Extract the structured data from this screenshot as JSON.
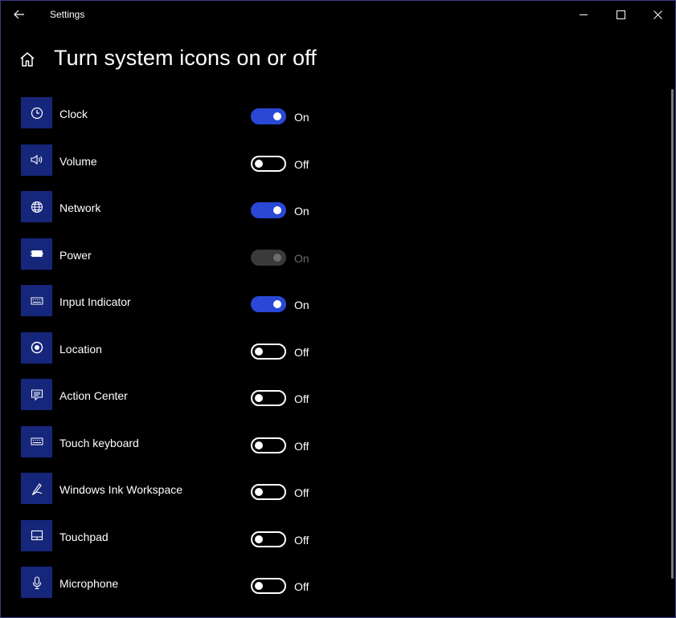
{
  "window": {
    "title": "Settings",
    "icons": {
      "back": "back-arrow-icon",
      "minimize": "minimize-icon",
      "maximize": "maximize-icon",
      "close": "close-icon"
    }
  },
  "page": {
    "title": "Turn system icons on or off",
    "home_icon": "home-icon"
  },
  "colors": {
    "accent": "#2a48d6",
    "tile": "#16267a",
    "disabled": "#3a3a3a",
    "disabled_text": "#6d6d6d"
  },
  "items": [
    {
      "label": "Clock",
      "icon": "clock-icon",
      "state": "On",
      "on": true,
      "disabled": false
    },
    {
      "label": "Volume",
      "icon": "volume-icon",
      "state": "Off",
      "on": false,
      "disabled": false
    },
    {
      "label": "Network",
      "icon": "globe-icon",
      "state": "On",
      "on": true,
      "disabled": false
    },
    {
      "label": "Power",
      "icon": "battery-icon",
      "state": "On",
      "on": true,
      "disabled": true
    },
    {
      "label": "Input Indicator",
      "icon": "keyboard-icon",
      "state": "On",
      "on": true,
      "disabled": false
    },
    {
      "label": "Location",
      "icon": "location-icon",
      "state": "Off",
      "on": false,
      "disabled": false
    },
    {
      "label": "Action Center",
      "icon": "action-center-icon",
      "state": "Off",
      "on": false,
      "disabled": false
    },
    {
      "label": "Touch keyboard",
      "icon": "keyboard-icon",
      "state": "Off",
      "on": false,
      "disabled": false
    },
    {
      "label": "Windows Ink Workspace",
      "icon": "pen-icon",
      "state": "Off",
      "on": false,
      "disabled": false
    },
    {
      "label": "Touchpad",
      "icon": "touchpad-icon",
      "state": "Off",
      "on": false,
      "disabled": false
    },
    {
      "label": "Microphone",
      "icon": "microphone-icon",
      "state": "Off",
      "on": false,
      "disabled": false
    }
  ]
}
